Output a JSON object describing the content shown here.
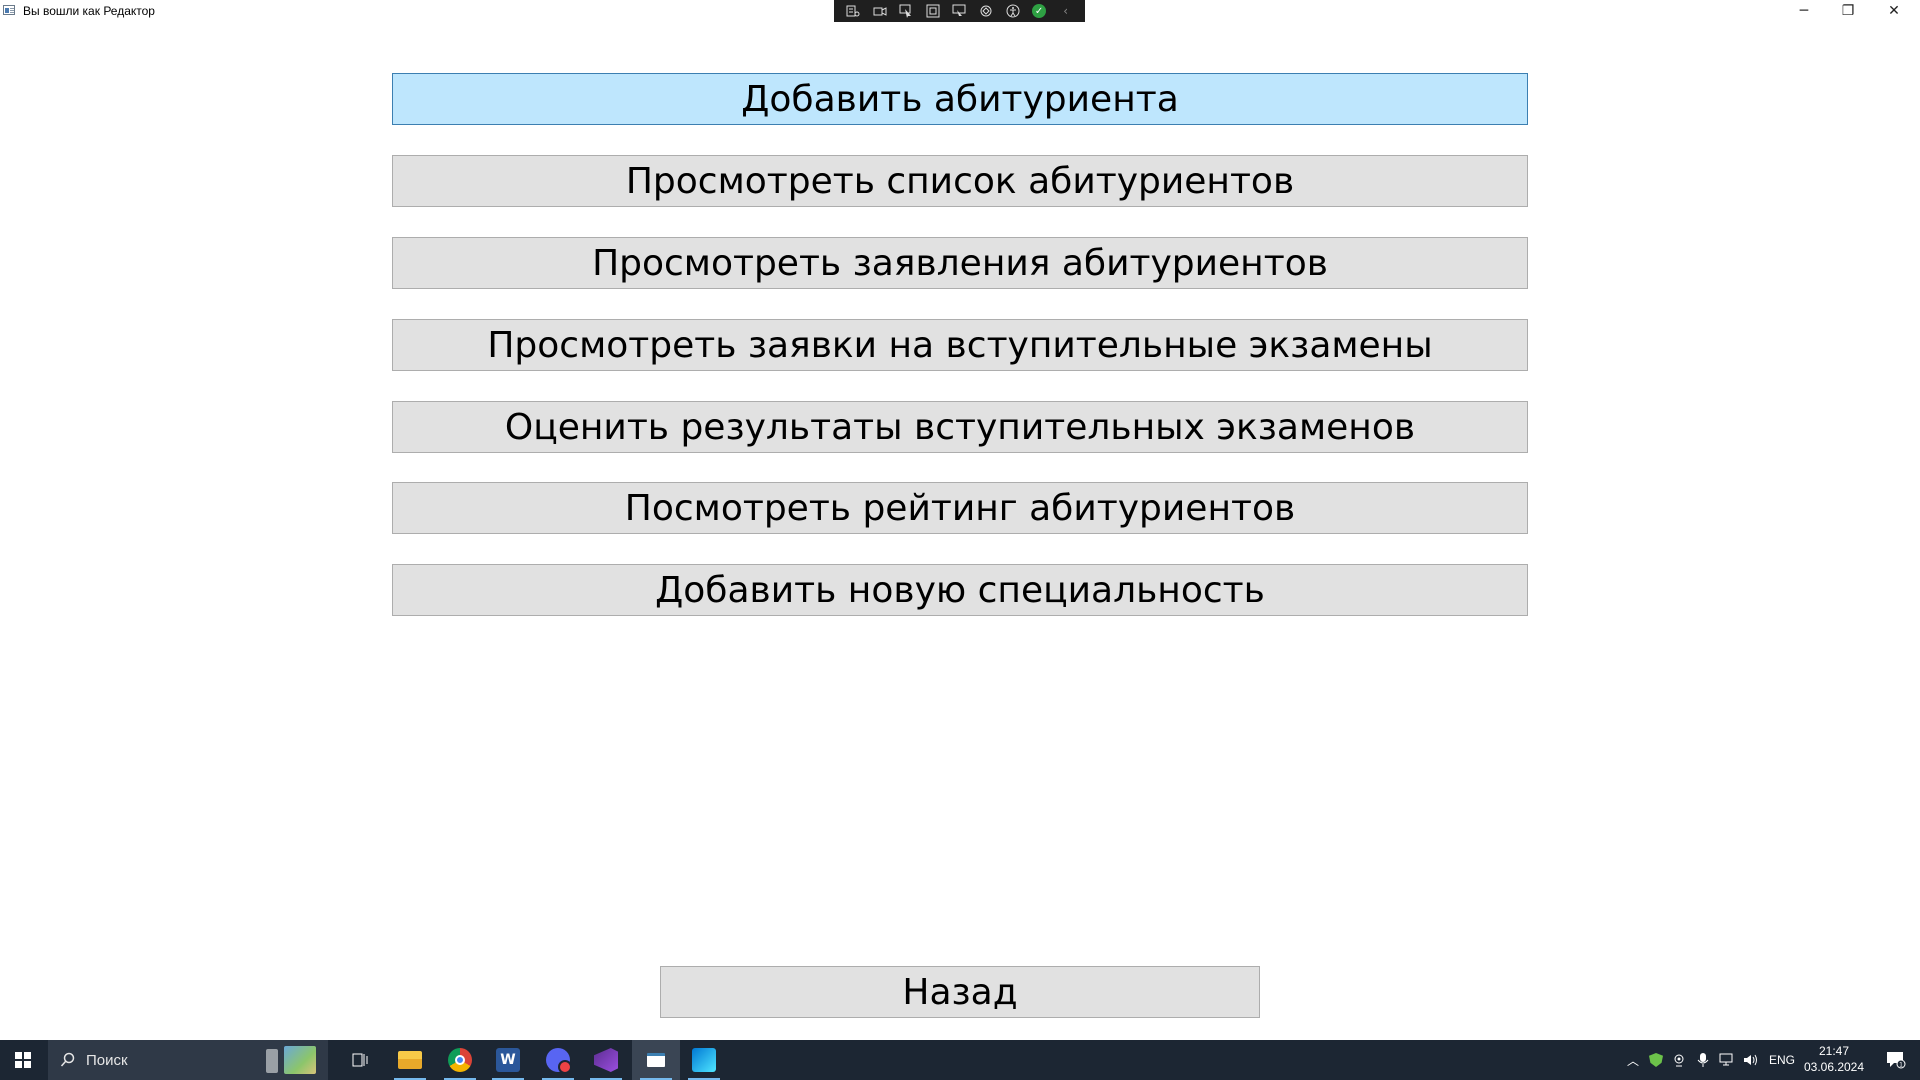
{
  "window": {
    "title": "Вы вошли как Редактор",
    "minimize": "─",
    "maximize": "❐",
    "close": "✕"
  },
  "menu": {
    "buttons": [
      {
        "label": "Добавить абитуриента"
      },
      {
        "label": "Просмотреть список абитуриентов"
      },
      {
        "label": "Просмотреть заявления абитуриентов"
      },
      {
        "label": "Просмотреть заявки на вступительные экзамены"
      },
      {
        "label": "Оценить результаты вступительных экзаменов"
      },
      {
        "label": "Посмотреть рейтинг абитуриентов"
      },
      {
        "label": "Добавить новую специальность"
      }
    ],
    "back_label": "Назад"
  },
  "taskbar": {
    "search_placeholder": "Поиск",
    "language": "ENG",
    "time": "21:47",
    "date": "03.06.2024",
    "apps": [
      {
        "icon": "task-view-icon"
      },
      {
        "icon": "file-explorer-icon"
      },
      {
        "icon": "chrome-icon"
      },
      {
        "icon": "word-icon"
      },
      {
        "icon": "discord-icon"
      },
      {
        "icon": "visual-studio-icon"
      },
      {
        "icon": "app-window-icon"
      },
      {
        "icon": "azure-data-studio-icon"
      }
    ]
  },
  "colors": {
    "button_bg": "#e1e1e1",
    "button_active_bg": "#bee6fd",
    "taskbar_bg": "#1c2633"
  }
}
